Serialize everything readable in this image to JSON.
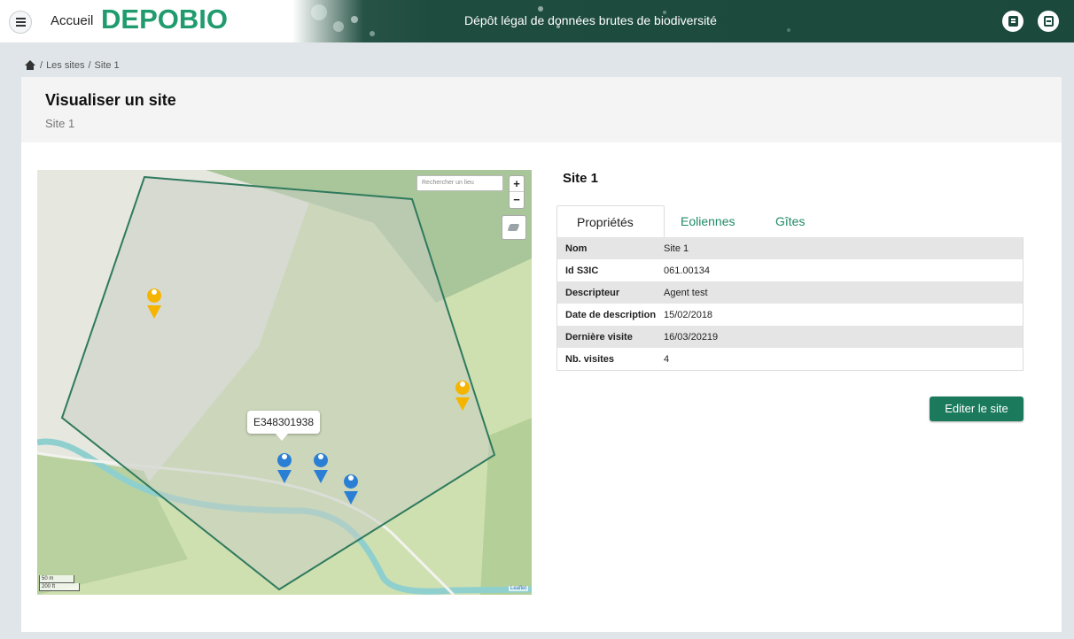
{
  "header": {
    "home_label": "Accueil",
    "logo_text": "DEPOBIO",
    "banner_title": "Dépôt légal de données brutes de biodiversité",
    "icons": [
      "menu-icon",
      "catalog-icon",
      "logout-icon"
    ]
  },
  "breadcrumb": {
    "separator": "/",
    "items": [
      "Les sites",
      "Site 1"
    ]
  },
  "page": {
    "title": "Visualiser un site",
    "subtitle": "Site 1"
  },
  "map": {
    "search_placeholder": "Rechercher un lieu",
    "zoom_in": "+",
    "zoom_out": "−",
    "popup_label": "E348301938",
    "scale_metric": "50 m",
    "scale_imperial": "200 ft",
    "attribution": "Leaflet",
    "markers": [
      {
        "color": "#f4b400",
        "kind": "site-marker"
      },
      {
        "color": "#f4b400",
        "kind": "site-marker"
      },
      {
        "color": "#2a7fd4",
        "kind": "eolienne-marker"
      },
      {
        "color": "#2a7fd4",
        "kind": "eolienne-marker"
      },
      {
        "color": "#2a7fd4",
        "kind": "eolienne-marker"
      }
    ]
  },
  "site": {
    "heading": "Site 1",
    "tabs": [
      {
        "label": "Propriétés",
        "active": true
      },
      {
        "label": "Eoliennes",
        "active": false
      },
      {
        "label": "Gîtes",
        "active": false
      }
    ],
    "properties": [
      {
        "key": "Nom",
        "value": "Site 1"
      },
      {
        "key": "Id S3IC",
        "value": "061.00134"
      },
      {
        "key": "Descripteur",
        "value": "Agent test"
      },
      {
        "key": "Date de description",
        "value": "15/02/2018"
      },
      {
        "key": "Dernière visite",
        "value": "16/03/20219"
      },
      {
        "key": "Nb. visites",
        "value": "4"
      }
    ],
    "edit_label": "Editer le site"
  },
  "colors": {
    "brand_green": "#1f9b6e",
    "banner_dark": "#1b4a3c",
    "button_green": "#1c7a5c",
    "polygon_stroke": "#2f7a5e"
  }
}
